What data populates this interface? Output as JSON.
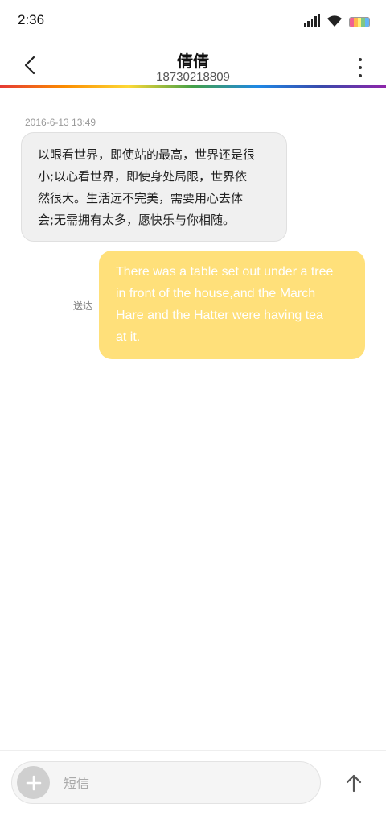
{
  "status_bar": {
    "time": "2:36",
    "battery_colors": [
      "#f06292",
      "#ffb74d",
      "#fff176",
      "#81c784",
      "#64b5f6"
    ]
  },
  "header": {
    "contact_name": "倩倩",
    "contact_number": "18730218809",
    "back_icon": "chevron-left-icon",
    "more_icon": "more-vertical-icon"
  },
  "conversation": {
    "timestamp": "2016-6-13 13:49",
    "incoming": {
      "lines": [
        "以眼看世界，即使站的最高，世界还是很",
        "小;以心看世界，即使身处局限，世界依",
        "然很大。生活远不完美，需要用心去体",
        "会;无需拥有太多，愿快乐与你相随。"
      ]
    },
    "outgoing": {
      "lines": [
        "There was a table set out under a tree",
        "in front of the house,and the March",
        "Hare and the Hatter were having tea",
        "at it."
      ],
      "status": "送达"
    }
  },
  "composer": {
    "placeholder": "短信",
    "value": "",
    "add_icon": "plus-icon",
    "send_icon": "arrow-up-icon"
  },
  "colors": {
    "incoming_bubble": "#f0f0f0",
    "outgoing_bubble": "#ffe07a",
    "accent_caret": "#2196f3"
  }
}
